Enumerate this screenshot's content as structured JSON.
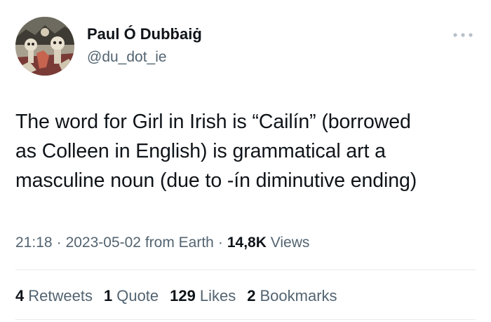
{
  "author": {
    "display_name": "Paul Ó Dubḃaiġ",
    "handle": "@du_dot_ie",
    "avatar_icon": "skeleton-artwork-avatar"
  },
  "more_icon": "more-horizontal-icon",
  "tweet": {
    "lines": [
      "The word for Girl in Irish is “Cailín” (borrowed",
      "as Colleen in English) is grammatical art a",
      "masculine noun (due to -ín diminutive ending)"
    ]
  },
  "meta": {
    "time": "21:18",
    "separator": "·",
    "date": "2023-05-02",
    "source": "from Earth",
    "views_count": "14,8K",
    "views_label": "Views"
  },
  "stats": {
    "retweets": {
      "count": "4",
      "label": "Retweets"
    },
    "quotes": {
      "count": "1",
      "label": "Quote"
    },
    "likes": {
      "count": "129",
      "label": "Likes"
    },
    "bookmarks": {
      "count": "2",
      "label": "Bookmarks"
    }
  },
  "colors": {
    "text_primary": "#0f1419",
    "text_secondary": "#536471",
    "divider": "#e6e9eb"
  }
}
